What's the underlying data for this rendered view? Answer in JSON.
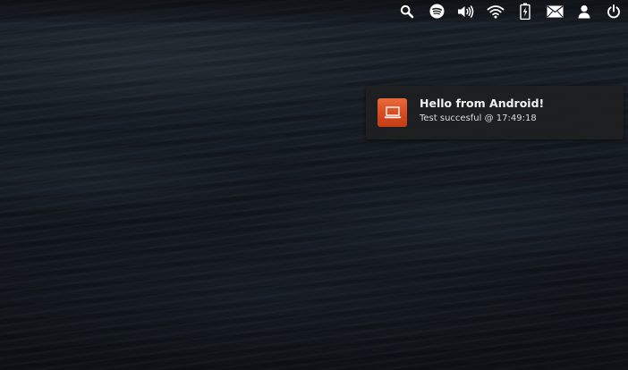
{
  "top_panel": {
    "tray_icons": [
      {
        "name": "search-icon"
      },
      {
        "name": "spotify-icon"
      },
      {
        "name": "volume-icon"
      },
      {
        "name": "wifi-icon"
      },
      {
        "name": "battery-icon"
      },
      {
        "name": "mail-icon"
      },
      {
        "name": "user-icon"
      },
      {
        "name": "power-icon"
      }
    ],
    "icon_color": "#ffffff"
  },
  "notification": {
    "title": "Hello from Android!",
    "body": "Test succesful @ 17:49:18",
    "app_icon": "laptop-icon",
    "icon_color": "#d94c21"
  }
}
